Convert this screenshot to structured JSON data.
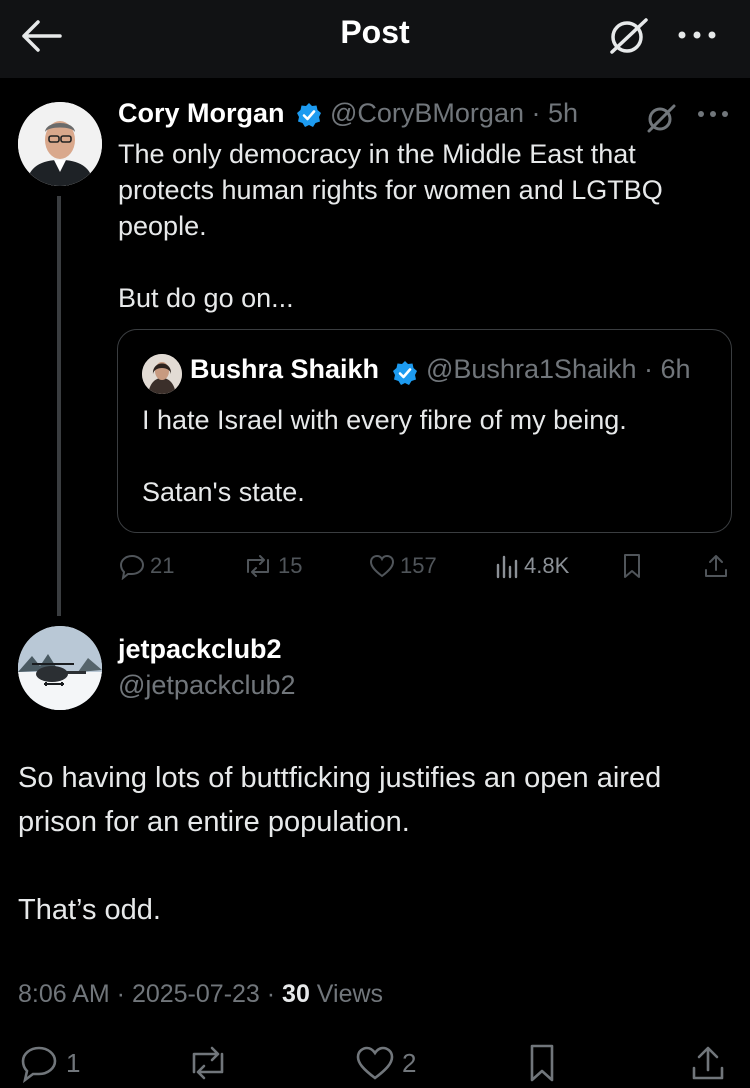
{
  "header": {
    "title": "Post",
    "back_icon": "arrow-left-icon",
    "grok_icon": "grok-icon",
    "more_icon": "more-icon"
  },
  "parent": {
    "name": "Cory Morgan",
    "handle": "@CoryBMorgan · 5h",
    "text_lines": [
      "The only democracy in the Middle East that protects human rights for women and LGTBQ people.",
      "But do go on..."
    ],
    "quote": {
      "name": "Bushra Shaikh",
      "handle": "@Bushra1Shaikh · 6h",
      "text_lines": [
        "I hate Israel with every fibre of my being.",
        "Satan's state."
      ]
    },
    "actions": {
      "replies": "21",
      "reposts": "15",
      "likes": "157",
      "views": "4.8K"
    }
  },
  "reply": {
    "name": "jetpackclub2",
    "handle": "@jetpackclub2",
    "text_lines": [
      "So having lots of buttficking justifies an open aired prison for an entire population.",
      "That’s odd."
    ],
    "meta": {
      "time_date": "8:06 AM · 2025-07-23 · ",
      "views_count": "30",
      "views_label": " Views"
    },
    "actions": {
      "replies": "1",
      "likes": "2"
    }
  },
  "colors": {
    "background": "#000000",
    "header": "#111214",
    "verified": "#1d9bf0",
    "muted": "#71767b"
  }
}
